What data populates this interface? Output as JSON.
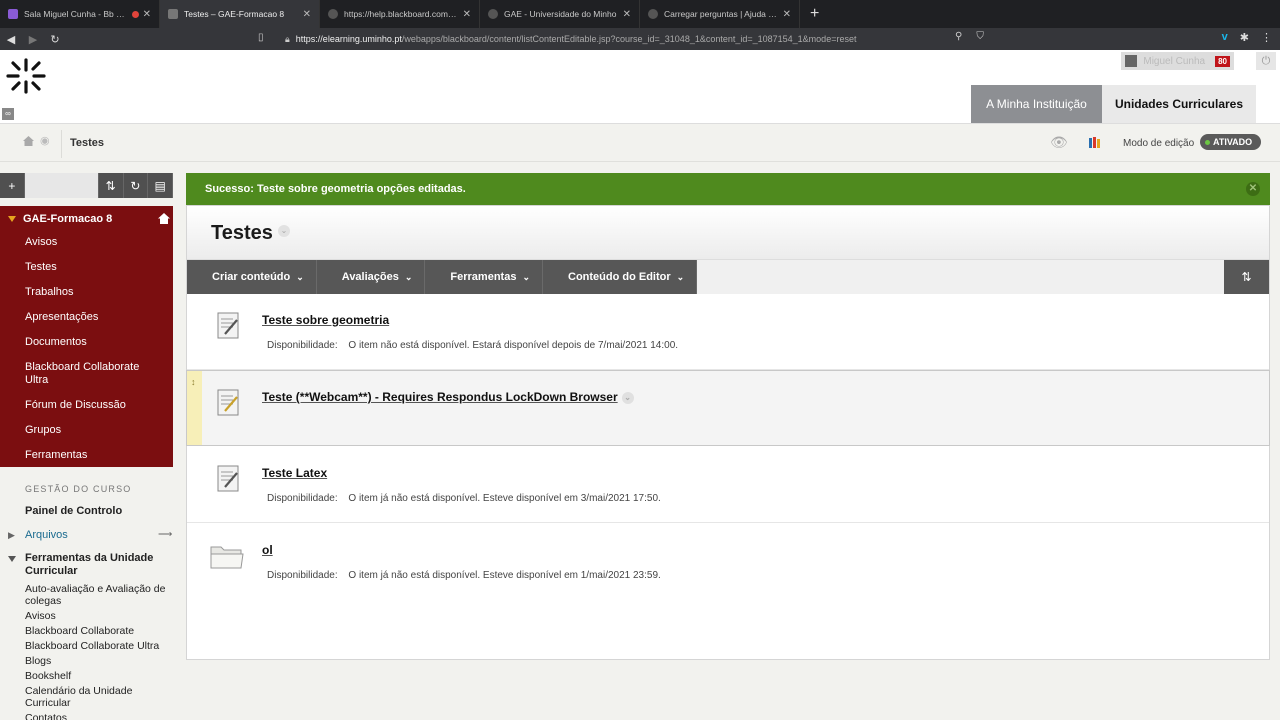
{
  "browser": {
    "tabs": [
      {
        "title": "Sala Miguel Cunha - Bb Collabo",
        "active": false,
        "recording": true
      },
      {
        "title": "Testes – GAE-Formacao 8",
        "active": true,
        "recording": false
      },
      {
        "title": "https://help.blackboard.com/sites/...",
        "active": false,
        "recording": false
      },
      {
        "title": "GAE - Universidade do Minho",
        "active": false,
        "recording": false
      },
      {
        "title": "Carregar perguntas | Ajuda da Blac",
        "active": false,
        "recording": false
      }
    ],
    "url_host": "https://elearning.uminho.pt",
    "url_path": "/webapps/blackboard/content/listContentEditable.jsp?course_id=_31048_1&content_id=_1087154_1&mode=reset"
  },
  "header": {
    "user_name": "Miguel Cunha",
    "notifications": "80",
    "tab_institution": "A Minha Instituição",
    "tab_units": "Unidades Curriculares"
  },
  "breadcrumb": {
    "current": "Testes",
    "edit_mode_label": "Modo de edição",
    "edit_mode_state": "ATIVADO"
  },
  "course_menu": {
    "title": "GAE-Formacao 8",
    "items": [
      "Avisos",
      "Testes",
      "Trabalhos",
      "Apresentações",
      "Documentos",
      "Blackboard Collaborate Ultra",
      "Fórum de Discussão",
      "Grupos",
      "Ferramentas"
    ]
  },
  "management": {
    "heading": "GESTÃO DO CURSO",
    "control_panel": "Painel de Controlo",
    "files": "Arquivos",
    "unit_tools": "Ferramentas da Unidade Curricular",
    "tools": [
      "Auto-avaliação e Avaliação de colegas",
      "Avisos",
      "Blackboard Collaborate",
      "Blackboard Collaborate Ultra",
      "Blogs",
      "Bookshelf",
      "Calendário da Unidade Curricular",
      "Contatos"
    ]
  },
  "success_message": "Sucesso: Teste sobre geometria opções editadas.",
  "page": {
    "title": "Testes",
    "actions": [
      "Criar conteúdo",
      "Avaliações",
      "Ferramentas",
      "Conteúdo do Editor"
    ]
  },
  "content_items": [
    {
      "title": "Teste sobre geometria",
      "icon": "test-icon",
      "availability_label": "Disponibilidade:",
      "availability": "O item não está disponível. Estará disponível depois de 7/mai/2021 14:00."
    },
    {
      "title": "Teste (**Webcam**) - Requires Respondus LockDown Browser",
      "icon": "test-icon",
      "availability_label": "",
      "availability": ""
    },
    {
      "title": "Teste Latex",
      "icon": "test-icon",
      "availability_label": "Disponibilidade:",
      "availability": "O item já não está disponível. Esteve disponível em 3/mai/2021 17:50."
    },
    {
      "title": "ol",
      "icon": "folder-icon",
      "availability_label": "Disponibilidade:",
      "availability": "O item já não está disponível. Esteve disponível em 1/mai/2021 23:59."
    }
  ],
  "colors": {
    "course_menu_bg": "#7b0e10",
    "success_bg": "#4f8a1e",
    "action_bar_bg": "#575757",
    "toggle_on": "#6cc644"
  }
}
